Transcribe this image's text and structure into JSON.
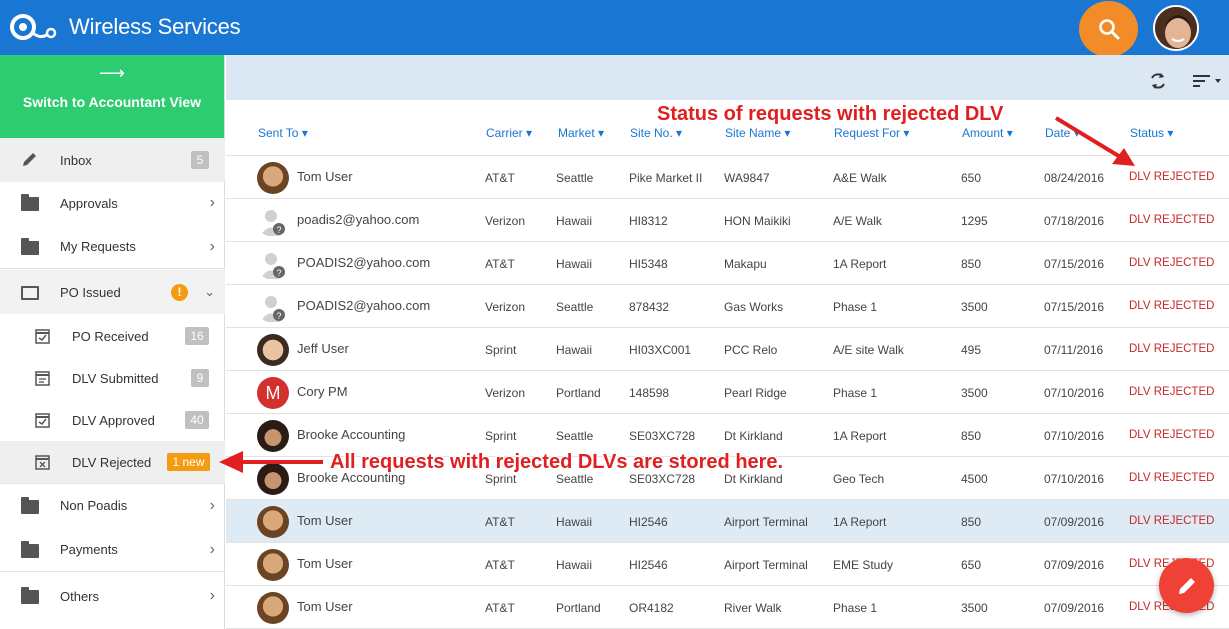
{
  "app": {
    "title": "Wireless Services"
  },
  "sidebar": {
    "switch_label": "Switch to Accountant View",
    "items": [
      {
        "label": "Inbox",
        "count": "5"
      },
      {
        "label": "Approvals"
      },
      {
        "label": "My Requests"
      },
      {
        "label": "PO Issued",
        "alert": "!"
      },
      {
        "label": "PO Received",
        "count": "16"
      },
      {
        "label": "DLV Submitted",
        "count": "9"
      },
      {
        "label": "DLV Approved",
        "count": "40"
      },
      {
        "label": "DLV Rejected",
        "badge": "1 new"
      },
      {
        "label": "Non Poadis"
      },
      {
        "label": "Payments"
      },
      {
        "label": "Others"
      }
    ]
  },
  "table": {
    "columns": [
      "Sent To",
      "Carrier",
      "Market",
      "Site No.",
      "Site Name",
      "Request For",
      "Amount",
      "Date",
      "Status"
    ],
    "rows": [
      {
        "sent_to": "Tom User",
        "carrier": "AT&T",
        "market": "Seattle",
        "site_no": "Pike Market II",
        "site_name": "WA9847",
        "request_for": "A&E Walk",
        "amount": "650",
        "date": "08/24/2016",
        "status": "DLV REJECTED"
      },
      {
        "sent_to": "poadis2@yahoo.com",
        "carrier": "Verizon",
        "market": "Hawaii",
        "site_no": "HI8312",
        "site_name": "HON Maikiki",
        "request_for": "A/E Walk",
        "amount": "1295",
        "date": "07/18/2016",
        "status": "DLV REJECTED"
      },
      {
        "sent_to": "POADIS2@yahoo.com",
        "carrier": "AT&T",
        "market": "Hawaii",
        "site_no": "HI5348",
        "site_name": "Makapu",
        "request_for": "1A Report",
        "amount": "850",
        "date": "07/15/2016",
        "status": "DLV REJECTED"
      },
      {
        "sent_to": "POADIS2@yahoo.com",
        "carrier": "Verizon",
        "market": "Seattle",
        "site_no": "878432",
        "site_name": "Gas Works",
        "request_for": "Phase 1",
        "amount": "3500",
        "date": "07/15/2016",
        "status": "DLV REJECTED"
      },
      {
        "sent_to": "Jeff User",
        "carrier": "Sprint",
        "market": "Hawaii",
        "site_no": "HI03XC001",
        "site_name": "PCC Relo",
        "request_for": "A/E site Walk",
        "amount": "495",
        "date": "07/11/2016",
        "status": "DLV REJECTED"
      },
      {
        "sent_to": "Cory PM",
        "carrier": "Verizon",
        "market": "Portland",
        "site_no": "148598",
        "site_name": "Pearl Ridge",
        "request_for": "Phase 1",
        "amount": "3500",
        "date": "07/10/2016",
        "status": "DLV REJECTED",
        "initial": "M"
      },
      {
        "sent_to": "Brooke Accounting",
        "carrier": "Sprint",
        "market": "Seattle",
        "site_no": "SE03XC728",
        "site_name": "Dt Kirkland",
        "request_for": "1A Report",
        "amount": "850",
        "date": "07/10/2016",
        "status": "DLV REJECTED"
      },
      {
        "sent_to": "Brooke Accounting",
        "carrier": "Sprint",
        "market": "Seattle",
        "site_no": "SE03XC728",
        "site_name": "Dt Kirkland",
        "request_for": "Geo Tech",
        "amount": "4500",
        "date": "07/10/2016",
        "status": "DLV REJECTED"
      },
      {
        "sent_to": "Tom User",
        "carrier": "AT&T",
        "market": "Hawaii",
        "site_no": "HI2546",
        "site_name": "Airport Terminal",
        "request_for": "1A Report",
        "amount": "850",
        "date": "07/09/2016",
        "status": "DLV REJECTED"
      },
      {
        "sent_to": "Tom User",
        "carrier": "AT&T",
        "market": "Hawaii",
        "site_no": "HI2546",
        "site_name": "Airport Terminal",
        "request_for": "EME Study",
        "amount": "650",
        "date": "07/09/2016",
        "status": "DLV REJECTED"
      },
      {
        "sent_to": "Tom User",
        "carrier": "AT&T",
        "market": "Portland",
        "site_no": "OR4182",
        "site_name": "River Walk",
        "request_for": "Phase 1",
        "amount": "3500",
        "date": "07/09/2016",
        "status": "DLV REJECTED"
      }
    ]
  },
  "annotations": {
    "status_note": "Status of requests with rejected DLV",
    "dlv_note": "All requests with rejected DLVs are stored here."
  },
  "colors": {
    "header": "#1976d2",
    "switch_view": "#2ecc71",
    "search_button": "#f28c28",
    "status_text": "#c62828",
    "annotation": "#e02020",
    "fab": "#ef4136"
  },
  "icons": [
    "logo-icon",
    "search-icon",
    "refresh-icon",
    "sort-icon",
    "pencil-icon",
    "folder-icon",
    "calendar-check-icon",
    "calendar-list-icon",
    "calendar-x-icon",
    "arrow-right-icon",
    "chevron-right-icon",
    "chevron-down-icon",
    "edit-icon"
  ]
}
